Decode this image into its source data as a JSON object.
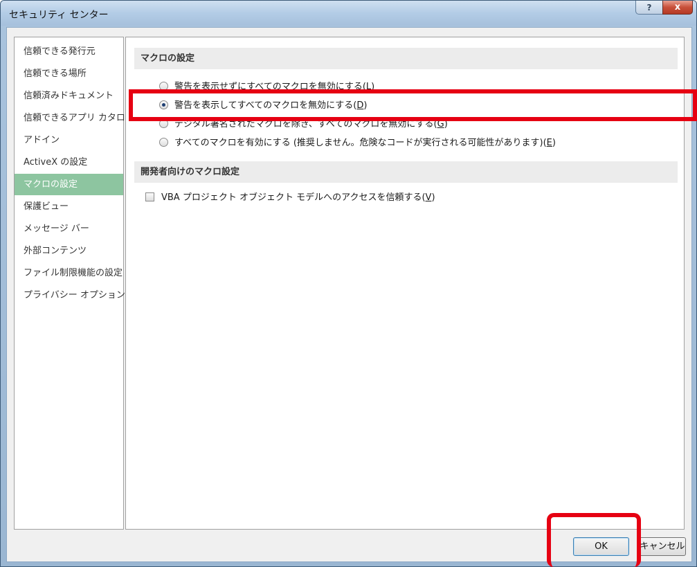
{
  "window": {
    "title": "セキュリティ センター",
    "help_label": "?",
    "close_label": "x"
  },
  "sidebar": {
    "items": [
      {
        "label": "信頼できる発行元"
      },
      {
        "label": "信頼できる場所"
      },
      {
        "label": "信頼済みドキュメント"
      },
      {
        "label": "信頼できるアプリ カタログ"
      },
      {
        "label": "アドイン"
      },
      {
        "label": "ActiveX の設定"
      },
      {
        "label": "マクロの設定",
        "selected": true
      },
      {
        "label": "保護ビュー"
      },
      {
        "label": "メッセージ バー"
      },
      {
        "label": "外部コンテンツ"
      },
      {
        "label": "ファイル制限機能の設定"
      },
      {
        "label": "プライバシー オプション"
      }
    ]
  },
  "macro_settings": {
    "header": "マクロの設定",
    "options": [
      {
        "text": "警告を表示せずにすべてのマクロを無効にする(",
        "key": "L",
        "close": ")",
        "checked": false
      },
      {
        "text": "警告を表示してすべてのマクロを無効にする(",
        "key": "D",
        "close": ")",
        "checked": true
      },
      {
        "text": "デジタル署名されたマクロを除き、すべてのマクロを無効にする(",
        "key": "G",
        "close": ")",
        "checked": false
      },
      {
        "text": "すべてのマクロを有効にする (推奨しません。危険なコードが実行される可能性があります)(",
        "key": "E",
        "close": ")",
        "checked": false
      }
    ]
  },
  "developer_settings": {
    "header": "開発者向けのマクロ設定",
    "vba_access": {
      "text": "VBA プロジェクト オブジェクト モデルへのアクセスを信頼する(",
      "key": "V",
      "close": ")",
      "checked": false
    }
  },
  "buttons": {
    "ok_label": "OK",
    "cancel_label": "キャンセル"
  },
  "highlight_color": "#e60012"
}
